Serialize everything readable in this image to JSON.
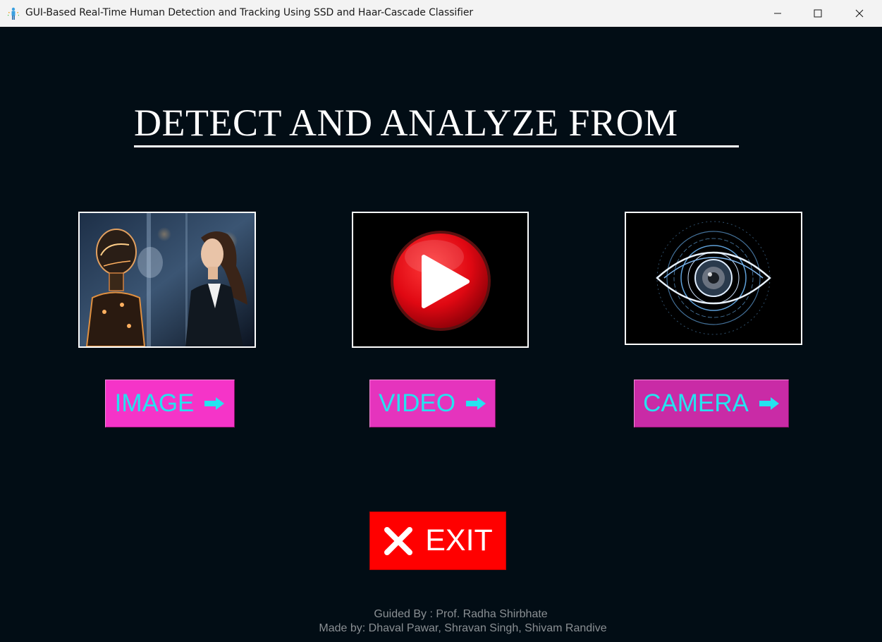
{
  "window": {
    "title": "GUI-Based Real-Time Human Detection and Tracking Using SSD and Haar-Cascade Classifier",
    "controls": [
      "minimize-icon",
      "maximize-icon",
      "close-icon"
    ]
  },
  "main": {
    "heading": "DETECT AND ANALYZE FROM ",
    "options": [
      {
        "label": "IMAGE",
        "icon": "arrow-right-icon",
        "thumbnail": "robot-and-woman-thumbnail"
      },
      {
        "label": "VIDEO",
        "icon": "arrow-right-icon",
        "thumbnail": "play-button-thumbnail"
      },
      {
        "label": "CAMERA",
        "icon": "arrow-right-icon",
        "thumbnail": "eye-lens-thumbnail"
      }
    ],
    "exit": {
      "label": "EXIT",
      "icon": "x-icon"
    }
  },
  "footer": {
    "guided_by": "Guided By : Prof. Radha Shirbhate",
    "made_by": "Made by: Dhaval Pawar, Shravan Singh, Shivam Randive"
  },
  "colors": {
    "background": "#020d15",
    "button_pink": "#f534c8",
    "button_text": "#24e3f0",
    "exit_red": "#ff0000",
    "footer_text": "#8a8f93"
  }
}
